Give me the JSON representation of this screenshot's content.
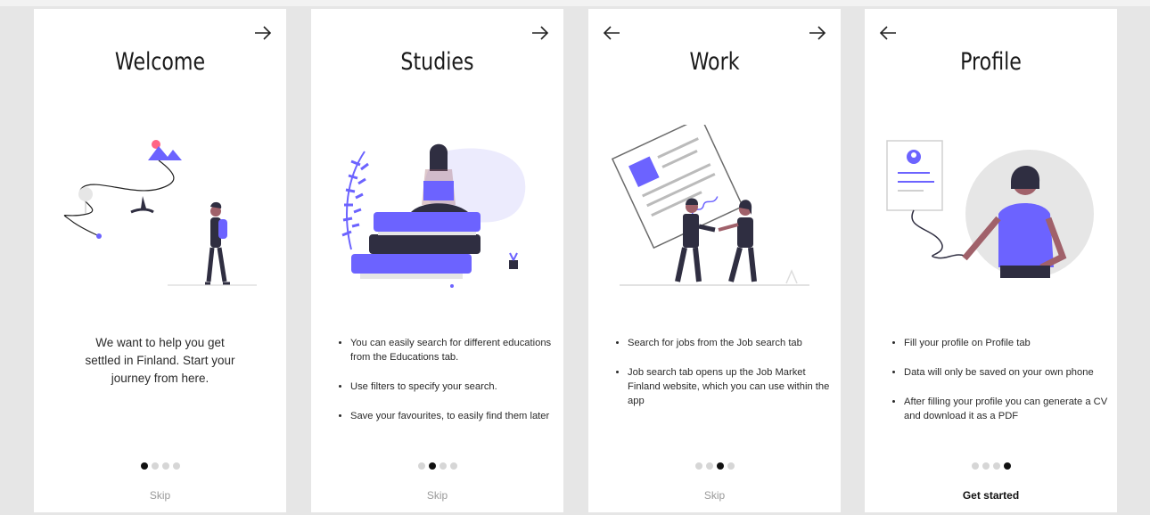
{
  "colors": {
    "accent": "#6c63ff",
    "dark": "#2f2e41",
    "skin": "#a0616a",
    "hair": "#2f2e41"
  },
  "screens": [
    {
      "title": "Welcome",
      "body": "We want to help you get settled in Finland. Start your journey from here.",
      "bullets": [],
      "active_dot": 1,
      "footer": "Skip",
      "has_back": false,
      "has_next": true,
      "illustration": "traveler-icon"
    },
    {
      "title": "Studies",
      "body": "",
      "bullets": [
        "You can easily search for different educations from the Educations tab.",
        "Use filters to specify your search.",
        "Save your favourites, to easily find them later"
      ],
      "active_dot": 2,
      "footer": "Skip",
      "has_back": false,
      "has_next": true,
      "illustration": "reading-books-icon"
    },
    {
      "title": "Work",
      "body": "",
      "bullets": [
        "Search for jobs from the Job search tab",
        "Job search tab opens up the Job Market Finland website, which you can use within the app"
      ],
      "active_dot": 3,
      "footer": "Skip",
      "has_back": true,
      "has_next": true,
      "illustration": "handshake-contract-icon"
    },
    {
      "title": "Profile",
      "body": "",
      "bullets": [
        "Fill your profile on Profile tab",
        "Data will only be saved on your own phone",
        "After filling your profile you can generate a CV and download it as a PDF"
      ],
      "active_dot": 4,
      "footer": "Get started",
      "has_back": true,
      "has_next": false,
      "illustration": "profile-card-icon"
    }
  ]
}
